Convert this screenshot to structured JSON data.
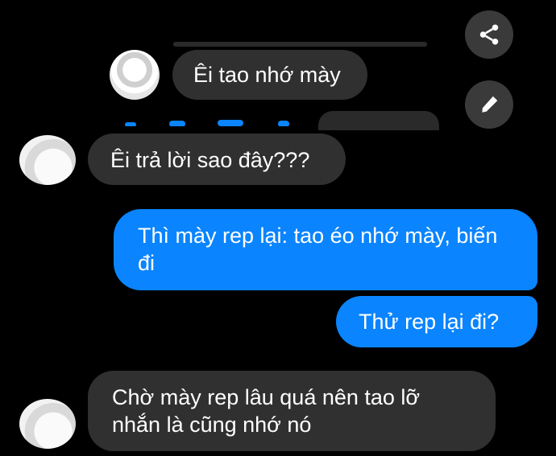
{
  "messages": [
    {
      "sender": "contact_1",
      "text": "Êi tao nhớ mày"
    },
    {
      "sender": "contact_2",
      "text": "Êi trả lời sao đây???"
    },
    {
      "sender": "me",
      "text": "Thì mày rep lại: tao éo nhớ mày, biến đi"
    },
    {
      "sender": "me",
      "text": "Thử rep lại đi?"
    },
    {
      "sender": "contact_2",
      "text": "Chờ mày rep lâu quá nên tao lỡ nhắn là cũng nhớ nó"
    }
  ],
  "actions": {
    "share_icon": "share-icon",
    "edit_icon": "pencil-icon"
  },
  "colors": {
    "background": "#000000",
    "incoming_bubble": "#303030",
    "outgoing_bubble": "#0a84ff",
    "text": "#ffffff"
  }
}
